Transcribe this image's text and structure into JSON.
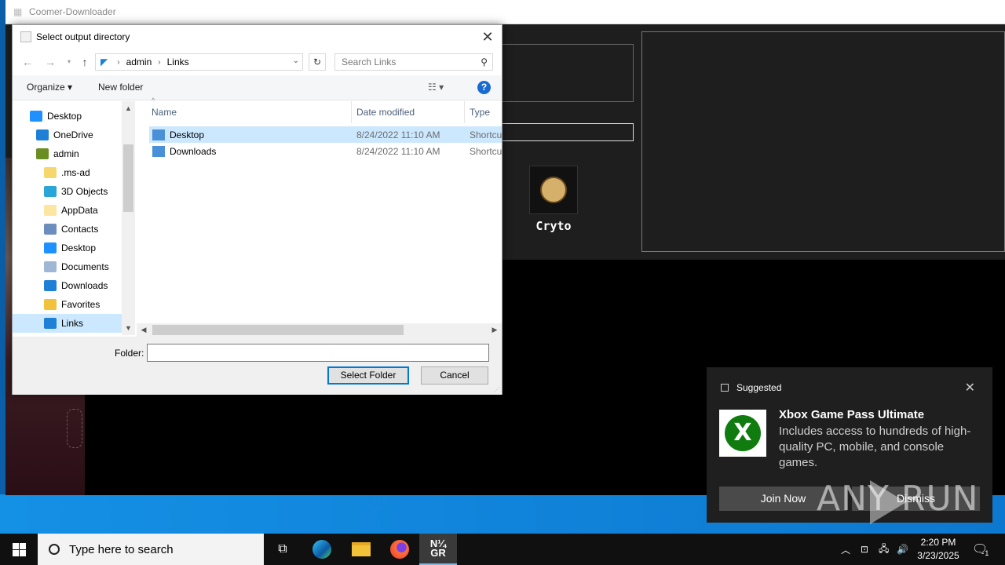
{
  "app": {
    "title": "Coomer-Downloader",
    "card_label": "Cryto"
  },
  "dialog": {
    "title": "Select output directory",
    "breadcrumb": [
      "admin",
      "Links"
    ],
    "search_placeholder": "Search Links",
    "toolbar": {
      "organize": "Organize",
      "new_folder": "New folder"
    },
    "tree": [
      {
        "label": "Desktop",
        "icon": "desktop-icon",
        "color": "#1e90ff"
      },
      {
        "label": "OneDrive",
        "icon": "cloud-icon",
        "color": "#1e7fd6"
      },
      {
        "label": "admin",
        "icon": "user-icon",
        "color": "#6b8e23"
      },
      {
        "label": ".ms-ad",
        "icon": "folder-icon",
        "color": "#f5d76e"
      },
      {
        "label": "3D Objects",
        "icon": "cube-icon",
        "color": "#2aa5d8"
      },
      {
        "label": "AppData",
        "icon": "folder-icon",
        "color": "#fbe7a1"
      },
      {
        "label": "Contacts",
        "icon": "contacts-icon",
        "color": "#6c8ebf"
      },
      {
        "label": "Desktop",
        "icon": "desktop-icon",
        "color": "#1e90ff"
      },
      {
        "label": "Documents",
        "icon": "documents-icon",
        "color": "#9fb7d5"
      },
      {
        "label": "Downloads",
        "icon": "download-icon",
        "color": "#1e7fd6"
      },
      {
        "label": "Favorites",
        "icon": "star-icon",
        "color": "#f2c13d"
      },
      {
        "label": "Links",
        "icon": "link-icon",
        "color": "#1e7fd6"
      }
    ],
    "columns": {
      "name": "Name",
      "date": "Date modified",
      "type": "Type"
    },
    "files": [
      {
        "name": "Desktop",
        "date": "8/24/2022 11:10 AM",
        "type": "Shortcut"
      },
      {
        "name": "Downloads",
        "date": "8/24/2022 11:10 AM",
        "type": "Shortcut"
      }
    ],
    "folder_label": "Folder:",
    "folder_value": "",
    "select_button": "Select Folder",
    "cancel_button": "Cancel"
  },
  "toast": {
    "header": "Suggested",
    "title": "Xbox Game Pass Ultimate",
    "body": "Includes access to hundreds of high-quality PC, mobile, and console games.",
    "join": "Join Now",
    "dismiss": "Dismiss"
  },
  "watermark": "ANY RUN",
  "taskbar": {
    "search_placeholder": "Type here to search",
    "time": "2:20 PM",
    "date": "3/23/2025",
    "notification_count": "1"
  }
}
